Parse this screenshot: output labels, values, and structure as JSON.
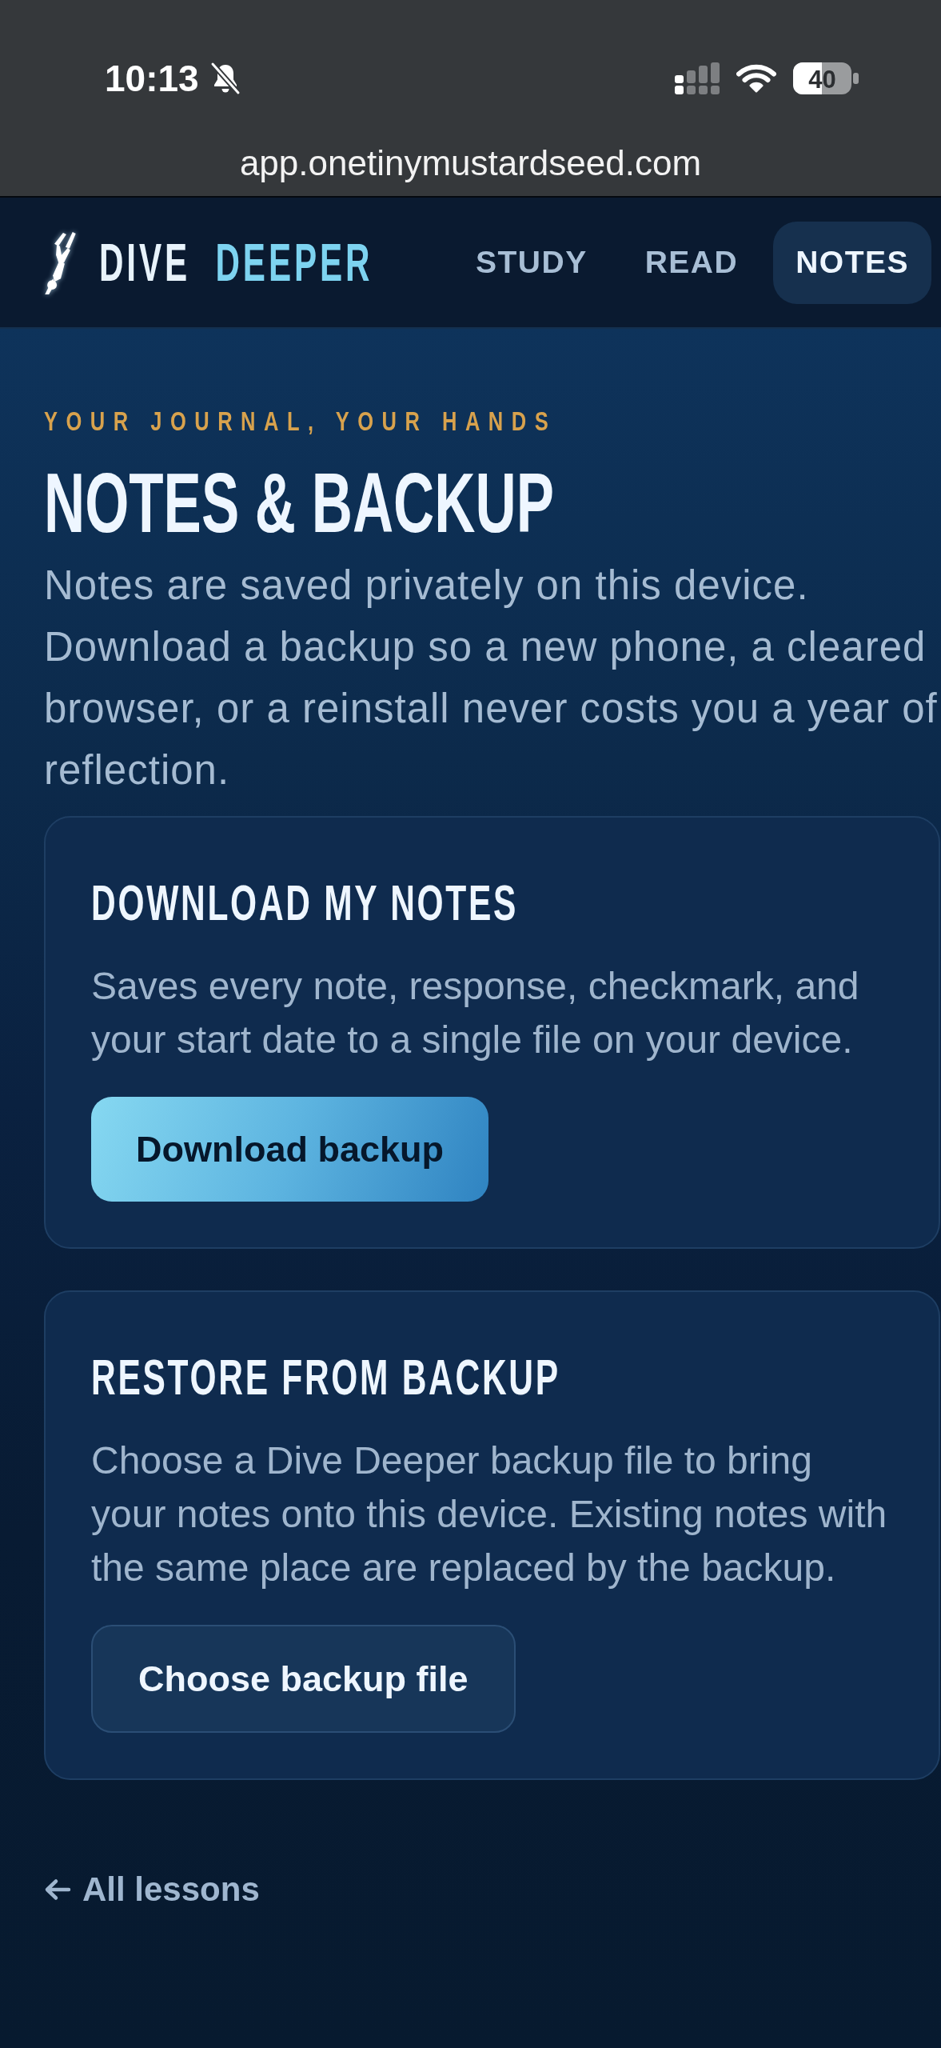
{
  "status_bar": {
    "time": "10:13",
    "battery": "40"
  },
  "browser": {
    "url": "app.onetinymustardseed.com"
  },
  "header": {
    "logo": {
      "word": "DIVE",
      "accent_word": "DEEPER"
    },
    "nav": [
      {
        "label": "STUDY",
        "selected": false
      },
      {
        "label": "READ",
        "selected": false
      },
      {
        "label": "NOTES",
        "selected": true
      }
    ]
  },
  "page": {
    "eyebrow": "YOUR JOURNAL, YOUR HANDS",
    "title": "NOTES & BACKUP",
    "intro": "Notes are saved privately on this device. Download a backup so a new phone, a cleared browser, or a reinstall never costs you a year of reflection."
  },
  "cards": [
    {
      "title": "DOWNLOAD MY NOTES",
      "text": "Saves every note, response, checkmark, and your start date to a single file on your device.",
      "button": {
        "label": "Download backup",
        "kind": "primary"
      }
    },
    {
      "title": "RESTORE FROM BACKUP",
      "text": "Choose a Dive Deeper backup file to bring your notes onto this device. Existing notes with the same place are replaced by the backup.",
      "button": {
        "label": "Choose backup file",
        "kind": "secondary"
      }
    }
  ],
  "back_link": {
    "label": "All lessons"
  }
}
